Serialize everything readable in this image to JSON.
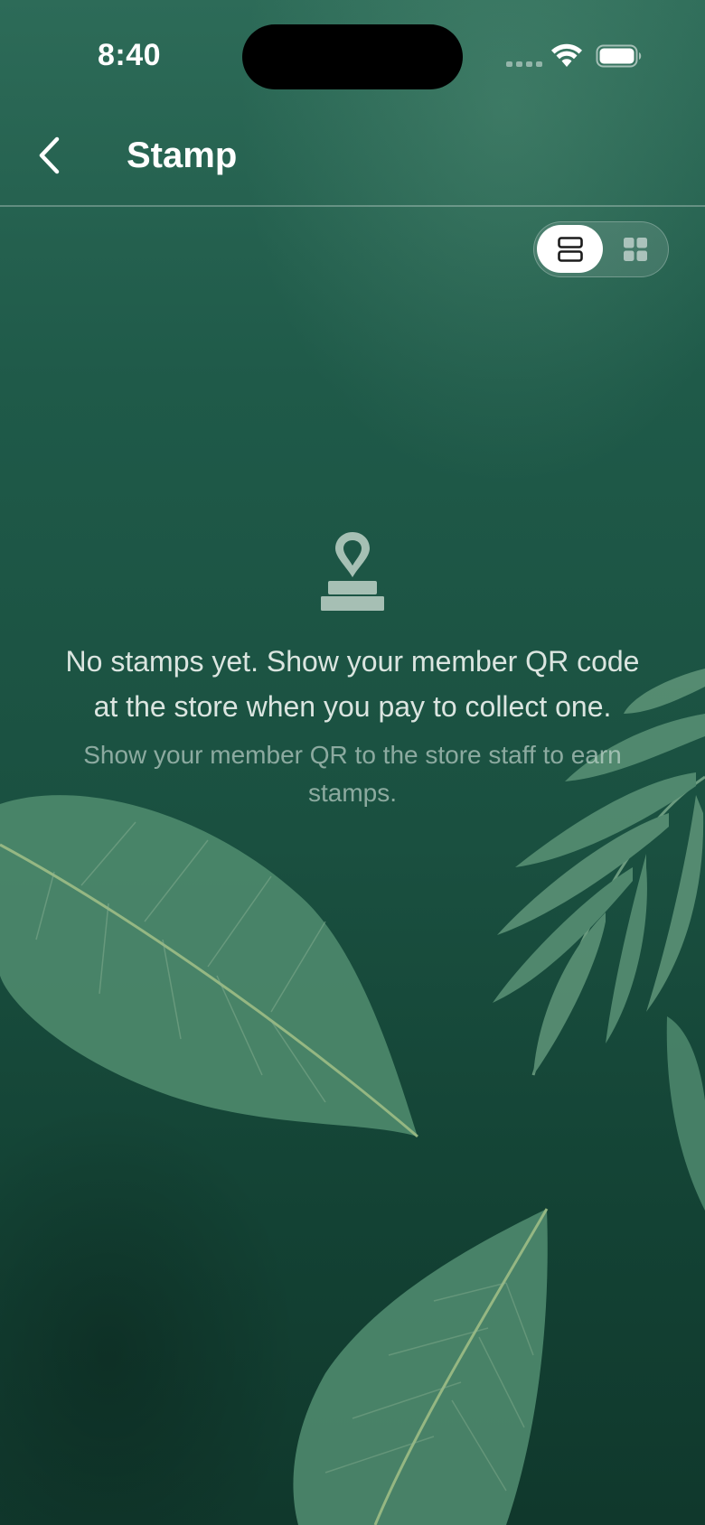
{
  "status_bar": {
    "time": "8:40"
  },
  "nav": {
    "title": "Stamp",
    "back_icon": "chevron-left-icon"
  },
  "view_toggle": {
    "selected": "list",
    "options": [
      {
        "name": "list",
        "icon": "list-view-icon"
      },
      {
        "name": "grid",
        "icon": "grid-view-icon"
      }
    ]
  },
  "empty_state": {
    "icon": "stamp-icon",
    "title": "No stamps yet. Show your member QR code at the store when you pay to collect one.",
    "subtitle": "Show your member QR to the store staff to earn stamps."
  },
  "colors": {
    "background_top": "#2d6b58",
    "background_bottom": "#10382c",
    "leaf": "#4f8a6e",
    "text_primary": "#ebf2ee"
  }
}
